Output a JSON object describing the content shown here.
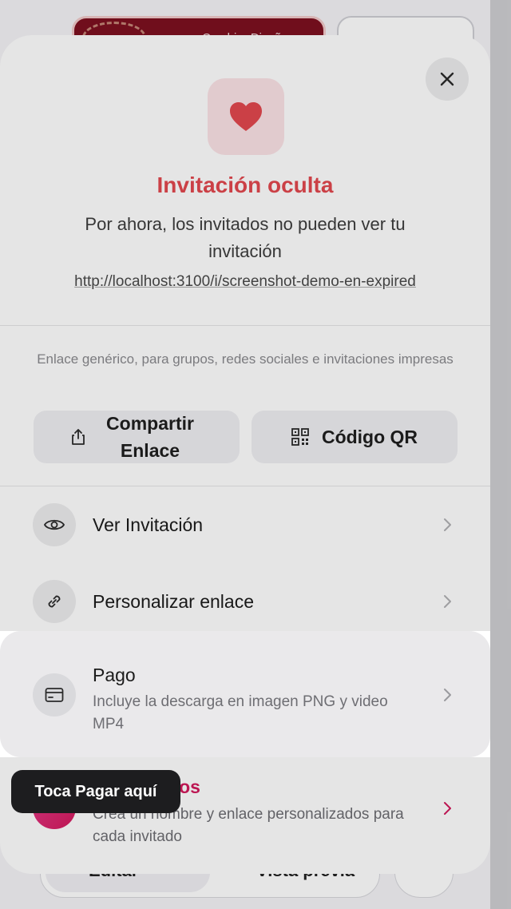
{
  "background": {
    "card_label": "Cambiar Diseño",
    "bottom_edit_label": "Editar",
    "bottom_preview_label": "Vista previa"
  },
  "sheet": {
    "close_icon": "close-icon",
    "heart_icon": "heart-icon",
    "title": "Invitación oculta",
    "subtitle": "Por ahora, los invitados no pueden ver tu invitación",
    "url": "http://localhost:3100/i/screenshot-demo-en-expired",
    "generic_text": "Enlace genérico, para grupos, redes sociales e invitaciones impresas",
    "share_button": "Compartir Enlace",
    "qr_button": "Código QR",
    "rows": [
      {
        "label": "Ver Invitación",
        "icon": "eye-icon"
      },
      {
        "label": "Personalizar enlace",
        "icon": "link-icon"
      }
    ],
    "payment": {
      "label": "Pago",
      "description": "Incluye la descarga en imagen PNG y video MP4",
      "icon": "credit-card-icon"
    },
    "guests": {
      "label": "Invitados",
      "description": "Crea un nombre y enlace personalizados para cada invitado"
    }
  },
  "tooltip": "Toca Pagar aquí",
  "colors": {
    "accent_red": "#e2484f",
    "accent_pink": "#d2195c",
    "tooltip_bg": "#1d1d1f"
  }
}
